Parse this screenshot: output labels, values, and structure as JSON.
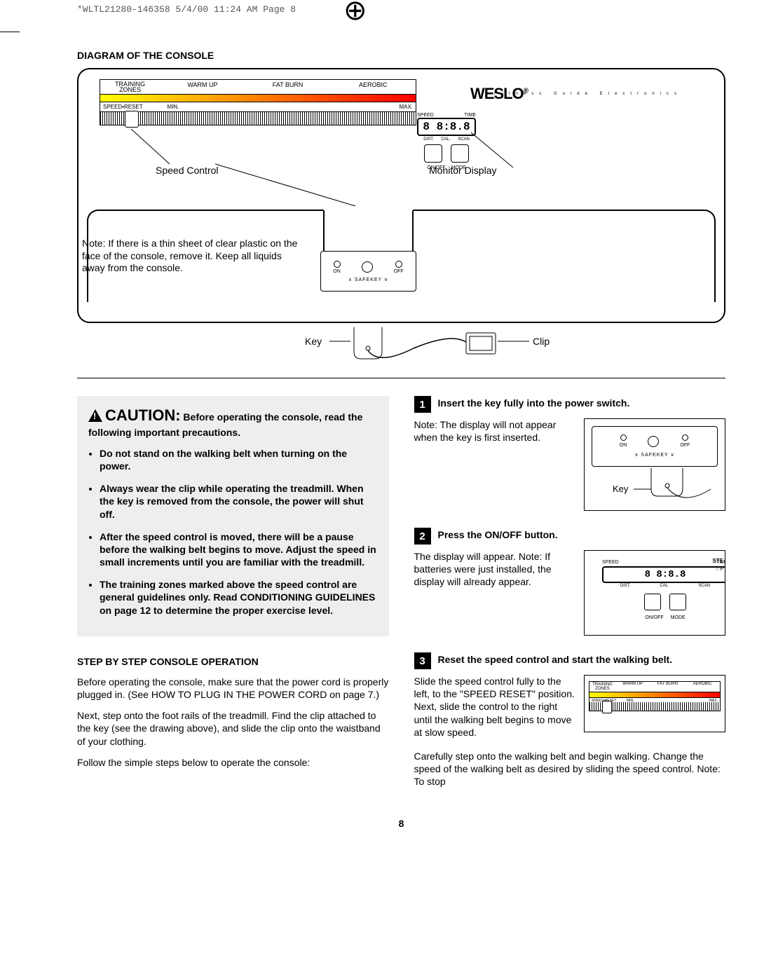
{
  "slug": "*WLTL21280-146358  5/4/00 11:24 AM  Page 8",
  "section1": "DIAGRAM OF THE CONSOLE",
  "console": {
    "zones_label": "TRAINING\nZONES",
    "zone_warmup": "WARM UP",
    "zone_fatburn": "FAT BURN",
    "zone_aerobic": "AEROBIC",
    "speed_reset": "SPEED•RESET",
    "min": "MIN.",
    "max": "MAX.",
    "brand": "WESLO",
    "brand_tag": "Fitness Guide Electronics",
    "lbl_speed": "SPEED",
    "lbl_time": "TIME",
    "lbl_dist": "DIST.",
    "lbl_cal": "CAL.",
    "lbl_scan": "SCAN",
    "lcd_digits": "8 8:8.8",
    "btn_onoff": "ON/OFF",
    "btn_mode": "MODE",
    "sk_on": "ON",
    "sk_off": "OFF",
    "sk_safekey": "SAFEKEY",
    "callout_speed": "Speed Control",
    "callout_monitor": "Monitor Display",
    "callout_key": "Key",
    "callout_clip": "Clip",
    "note": "Note: If there is a thin sheet of clear plastic on the face of the console, remove it. Keep all liquids away from the console."
  },
  "caution": {
    "head": "CAUTION:",
    "intro": " Before operating the console, read the following important precautions.",
    "items": [
      "Do not stand on the walking belt when turning on the power.",
      "Always wear the clip while operating the treadmill. When the key is removed from the console, the power will shut off.",
      "After the speed control is moved, there will be a pause before the walking belt begins to move. Adjust the speed in small increments until you are familiar with the treadmill.",
      "The training zones marked above the speed control are general guidelines only. Read CONDITIONING GUIDELINES on page 12 to determine the proper exercise level."
    ]
  },
  "section2": "STEP BY STEP CONSOLE OPERATION",
  "intro_paras": [
    "Before operating the console, make sure that the power cord is properly plugged in. (See HOW TO PLUG IN THE POWER CORD on page 7.)",
    "Next, step onto the foot rails of the treadmill. Find the clip attached to the key (see the drawing above), and slide the clip onto the waistband of your clothing.",
    "Follow the simple steps below to operate the console:"
  ],
  "steps": [
    {
      "n": "1",
      "title": "Insert the key fully into the power switch.",
      "body": "Note: The display will not appear when the key is first inserted.",
      "fig_key": "Key"
    },
    {
      "n": "2",
      "title": "Press the ON/OFF button.",
      "body": "The display will appear. Note: If batteries were just installed, the display will already appear."
    },
    {
      "n": "3",
      "title": "Reset the speed control and start the walking belt.",
      "body": "Slide the speed control fully to the left, to the \"SPEED RESET\" position. Next, slide the control to the right until the walking belt begins to move at slow speed.",
      "body2": "Carefully step onto the walking belt and begin walking. Change the speed of the walking belt as desired by sliding the speed control. Note: To stop"
    }
  ],
  "page_number": "8"
}
